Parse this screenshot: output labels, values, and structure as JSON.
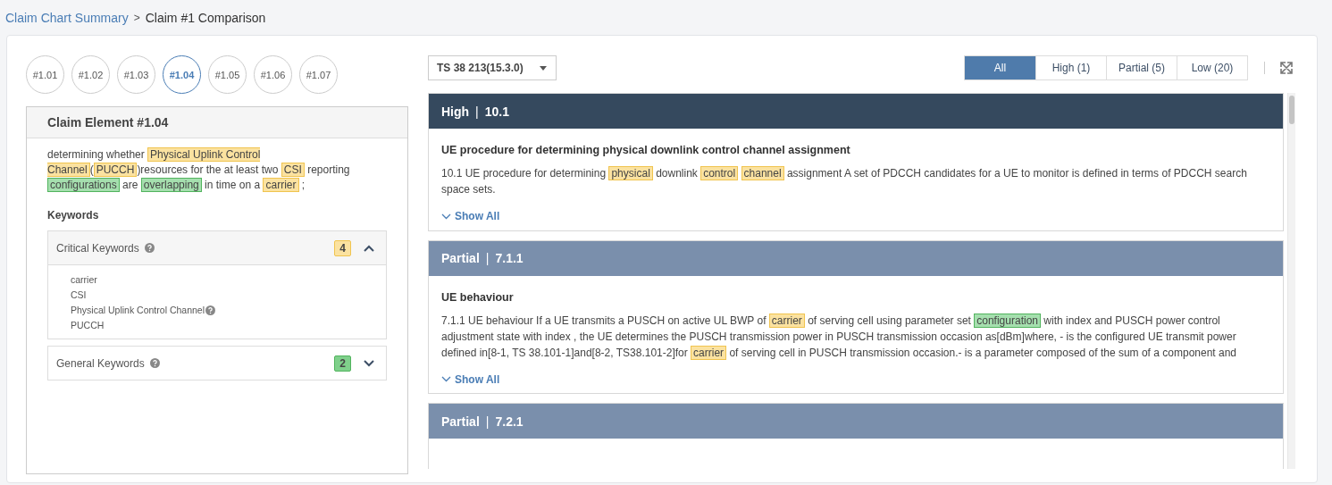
{
  "breadcrumb": {
    "link": "Claim Chart Summary",
    "separator": ">",
    "current": "Claim #1 Comparison"
  },
  "claim_elements": [
    {
      "label": "#1.01",
      "selected": false
    },
    {
      "label": "#1.02",
      "selected": false
    },
    {
      "label": "#1.03",
      "selected": false
    },
    {
      "label": "#1.04",
      "selected": true
    },
    {
      "label": "#1.05",
      "selected": false
    },
    {
      "label": "#1.06",
      "selected": false
    },
    {
      "label": "#1.07",
      "selected": false
    }
  ],
  "claim_element": {
    "title": "Claim Element #1.04",
    "text": [
      {
        "kind": "plain",
        "text": "determining whether "
      },
      {
        "kind": "critical",
        "text": "Physical Uplink Control Channel"
      },
      {
        "kind": "plain",
        "text": "("
      },
      {
        "kind": "critical",
        "text": "PUCCH"
      },
      {
        "kind": "plain",
        "text": ")resources for the at least two "
      },
      {
        "kind": "critical",
        "text": "CSI"
      },
      {
        "kind": "plain",
        "text": " reporting "
      },
      {
        "kind": "general",
        "text": "configurations"
      },
      {
        "kind": "plain",
        "text": " are "
      },
      {
        "kind": "general",
        "text": "overlapping"
      },
      {
        "kind": "plain",
        "text": " in time on a "
      },
      {
        "kind": "critical",
        "text": "carrier"
      },
      {
        "kind": "plain",
        "text": " ;"
      }
    ],
    "keywords_heading": "Keywords",
    "keyword_groups": [
      {
        "title": "Critical Keywords",
        "kind": "critical",
        "count": "4",
        "expanded": true,
        "items": [
          {
            "label": "carrier",
            "help": false
          },
          {
            "label": "CSI",
            "help": false
          },
          {
            "label": "Physical Uplink Control Channel",
            "help": true
          },
          {
            "label": "PUCCH",
            "help": false
          }
        ]
      },
      {
        "title": "General Keywords",
        "kind": "general",
        "count": "2",
        "expanded": false
      }
    ]
  },
  "spec_select": {
    "value": "TS 38 213(15.3.0)"
  },
  "filters": [
    {
      "label": "All",
      "selected": true
    },
    {
      "label": "High (1)",
      "selected": false
    },
    {
      "label": "Partial (5)",
      "selected": false
    },
    {
      "label": "Low (20)",
      "selected": false
    }
  ],
  "result_separator": "|",
  "results": [
    {
      "kind": "high",
      "level": "High",
      "section": "10.1",
      "title": "UE procedure for determining physical downlink control channel assignment",
      "text": [
        {
          "kind": "plain",
          "text": "10.1 UE procedure for determining "
        },
        {
          "kind": "critical",
          "text": "physical"
        },
        {
          "kind": "plain",
          "text": " downlink "
        },
        {
          "kind": "critical",
          "text": "control"
        },
        {
          "kind": "critical",
          "text": "channel"
        },
        {
          "kind": "plain",
          "text": " assignment A set of PDCCH candidates for a UE to monitor is defined in terms of PDCCH search space sets."
        }
      ],
      "show_all": "Show All"
    },
    {
      "kind": "partial",
      "level": "Partial",
      "section": "7.1.1",
      "title": "UE behaviour",
      "text": [
        {
          "kind": "plain",
          "text": "7.1.1 UE behaviour If a UE transmits a PUSCH on active UL BWP of "
        },
        {
          "kind": "critical",
          "text": "carrier"
        },
        {
          "kind": "plain",
          "text": " of serving cell using parameter set "
        },
        {
          "kind": "general",
          "text": "configuration"
        },
        {
          "kind": "plain",
          "text": " with index and PUSCH power control adjustment state with index , the UE determines the PUSCH transmission power in PUSCH transmission occasion as[dBm]where, - is the configured UE transmit power defined in[8-1, TS 38.101-1]and[8-2, TS38.101-2]for "
        },
        {
          "kind": "critical",
          "text": "carrier"
        },
        {
          "kind": "plain",
          "text": " of serving cell in PUSCH transmission occasion.- is a parameter composed of the sum of a component and"
        }
      ],
      "show_all": "Show All"
    },
    {
      "kind": "partial",
      "level": "Partial",
      "section": "7.2.1"
    }
  ]
}
